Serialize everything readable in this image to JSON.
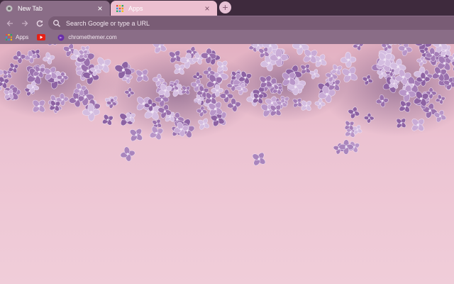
{
  "tabs": [
    {
      "label": "New Tab",
      "active": true
    },
    {
      "label": "Apps",
      "active": false
    }
  ],
  "new_tab_button": "+",
  "close_glyph": "×",
  "omnibox": {
    "placeholder": "Search Google or type a URL"
  },
  "bookmarks": [
    {
      "label": "Apps",
      "icon": "apps-grid-icon"
    },
    {
      "label": "",
      "icon": "youtube-icon"
    },
    {
      "label": "chromethemer.com",
      "icon": "chromethemer-icon"
    }
  ],
  "colors": {
    "tabstrip": "#3e2a3d",
    "toolbar": "#8a6d87",
    "omnibox": "#795c75",
    "inactive_tab": "#ecbfd0",
    "background": "#e9bfcc",
    "flower": "#a87fb8"
  },
  "background_image": "lilac-flowers-on-pink"
}
